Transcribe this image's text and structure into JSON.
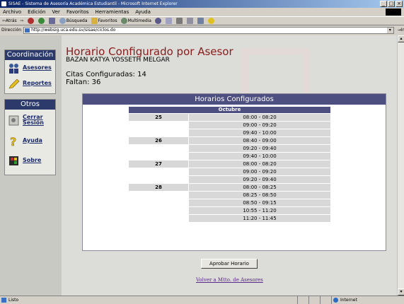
{
  "window": {
    "title": "SISAE - Sistema de Asesoría Académica Estudiantil - Microsoft Internet Explorer",
    "controls": [
      "_",
      "□",
      "×"
    ]
  },
  "menu": [
    "Archivo",
    "Edición",
    "Ver",
    "Favoritos",
    "Herramientas",
    "Ayuda"
  ],
  "toolbar": {
    "back": "Atrás",
    "search": "Búsqueda",
    "favorites": "Favoritos",
    "media": "Multimedia"
  },
  "address": {
    "label": "Dirección",
    "url": "http://websig.uca.edu.sv/sisae/ciclos.do",
    "go": "Ir"
  },
  "sidebar": {
    "section1": {
      "title": "Coordinación",
      "items": [
        {
          "label": "Asesores",
          "icon": "people-icon"
        },
        {
          "label": "Reportes",
          "icon": "pencil-icon"
        }
      ]
    },
    "section2": {
      "title": "Otros",
      "items": [
        {
          "label": "Cerrar Sesión",
          "icon": "logout-icon"
        },
        {
          "label": "Ayuda",
          "icon": "help-icon"
        },
        {
          "label": "Sobre",
          "icon": "about-icon"
        }
      ]
    }
  },
  "main": {
    "title": "Horario Configurado por Asesor",
    "advisor": "BAZAN KATYA YOSSETH MELGAR",
    "citas_label": "Citas Configuradas: 14",
    "faltan_label": "Faltan: 36",
    "panel_title": "Horarios Configurados",
    "month": "Octubre",
    "rows": [
      {
        "day": "25",
        "time": "08:00 - 08:20"
      },
      {
        "day": "",
        "time": "09:00 - 09:20"
      },
      {
        "day": "",
        "time": "09:40 - 10:00"
      },
      {
        "day": "26",
        "time": "08:40 - 09:00"
      },
      {
        "day": "",
        "time": "09:20 - 09:40"
      },
      {
        "day": "",
        "time": "09:40 - 10:00"
      },
      {
        "day": "27",
        "time": "08:00 - 08:20"
      },
      {
        "day": "",
        "time": "09:00 - 09:20"
      },
      {
        "day": "",
        "time": "09:20 - 09:40"
      },
      {
        "day": "28",
        "time": "08:00 - 08:25"
      },
      {
        "day": "",
        "time": "08:25 - 08:50"
      },
      {
        "day": "",
        "time": "08:50 - 09:15"
      },
      {
        "day": "",
        "time": "10:55 - 11:20"
      },
      {
        "day": "",
        "time": "11:20 - 11:45"
      }
    ],
    "approve_button": "Aprobar Horario",
    "back_link": "Volver a Mtto. de Asesores"
  },
  "status": {
    "text": "Listo",
    "zone": "Internet"
  }
}
